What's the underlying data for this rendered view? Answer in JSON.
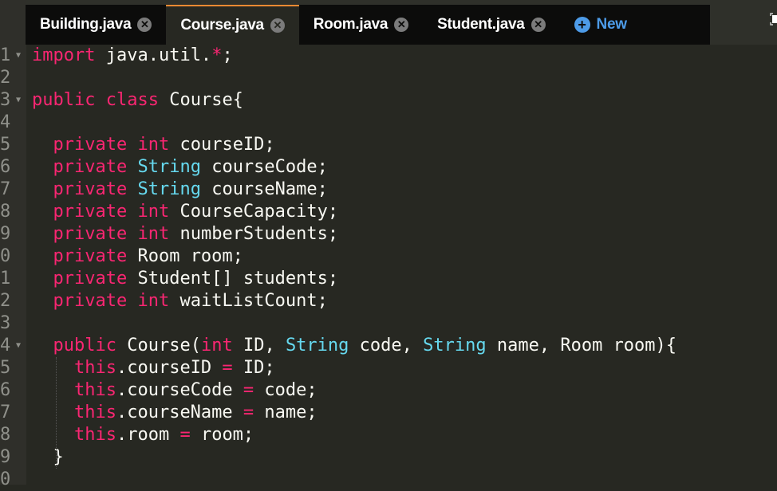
{
  "tabs": [
    {
      "label": "Building.java",
      "active": false
    },
    {
      "label": "Course.java",
      "active": true
    },
    {
      "label": "Room.java",
      "active": false
    },
    {
      "label": "Student.java",
      "active": false
    }
  ],
  "new_tab_label": "New",
  "colors": {
    "background": "#272822",
    "keyword": "#f92672",
    "type": "#66d9ef",
    "text": "#f8f8f2",
    "active_tab_accent": "#f58a33",
    "new_button": "#4d9be8"
  },
  "code_lines": [
    {
      "n": "1",
      "fold": true
    },
    {
      "n": "2"
    },
    {
      "n": "3",
      "fold": true
    },
    {
      "n": "4"
    },
    {
      "n": "5"
    },
    {
      "n": "6"
    },
    {
      "n": "7"
    },
    {
      "n": "8"
    },
    {
      "n": "9"
    },
    {
      "n": "0"
    },
    {
      "n": "1"
    },
    {
      "n": "2"
    },
    {
      "n": "3"
    },
    {
      "n": "4",
      "fold": true
    },
    {
      "n": "5"
    },
    {
      "n": "6"
    },
    {
      "n": "7"
    },
    {
      "n": "8"
    },
    {
      "n": "9"
    },
    {
      "n": "0"
    }
  ],
  "code": [
    [
      [
        "kw",
        "import"
      ],
      [
        "t",
        " java.util."
      ],
      [
        "kw",
        "*"
      ],
      [
        "t",
        ";"
      ]
    ],
    [],
    [
      [
        "kw",
        "public"
      ],
      [
        "t",
        " "
      ],
      [
        "kw",
        "class"
      ],
      [
        "t",
        " Course{"
      ]
    ],
    [],
    [
      [
        "t",
        "  "
      ],
      [
        "kw",
        "private"
      ],
      [
        "t",
        " "
      ],
      [
        "kw",
        "int"
      ],
      [
        "t",
        " courseID;"
      ]
    ],
    [
      [
        "t",
        "  "
      ],
      [
        "kw",
        "private"
      ],
      [
        "t",
        " "
      ],
      [
        "ty",
        "String"
      ],
      [
        "t",
        " courseCode;"
      ]
    ],
    [
      [
        "t",
        "  "
      ],
      [
        "kw",
        "private"
      ],
      [
        "t",
        " "
      ],
      [
        "ty",
        "String"
      ],
      [
        "t",
        " courseName;"
      ]
    ],
    [
      [
        "t",
        "  "
      ],
      [
        "kw",
        "private"
      ],
      [
        "t",
        " "
      ],
      [
        "kw",
        "int"
      ],
      [
        "t",
        " CourseCapacity;"
      ]
    ],
    [
      [
        "t",
        "  "
      ],
      [
        "kw",
        "private"
      ],
      [
        "t",
        " "
      ],
      [
        "kw",
        "int"
      ],
      [
        "t",
        " numberStudents;"
      ]
    ],
    [
      [
        "t",
        "  "
      ],
      [
        "kw",
        "private"
      ],
      [
        "t",
        " Room room;"
      ]
    ],
    [
      [
        "t",
        "  "
      ],
      [
        "kw",
        "private"
      ],
      [
        "t",
        " Student[] students;"
      ]
    ],
    [
      [
        "t",
        "  "
      ],
      [
        "kw",
        "private"
      ],
      [
        "t",
        " "
      ],
      [
        "kw",
        "int"
      ],
      [
        "t",
        " waitListCount;"
      ]
    ],
    [],
    [
      [
        "t",
        "  "
      ],
      [
        "kw",
        "public"
      ],
      [
        "t",
        " Course("
      ],
      [
        "kw",
        "int"
      ],
      [
        "t",
        " ID, "
      ],
      [
        "ty",
        "String"
      ],
      [
        "t",
        " code, "
      ],
      [
        "ty",
        "String"
      ],
      [
        "t",
        " name, Room room){"
      ]
    ],
    [
      [
        "t",
        "    "
      ],
      [
        "kw",
        "this"
      ],
      [
        "t",
        ".courseID "
      ],
      [
        "kw",
        "="
      ],
      [
        "t",
        " ID;"
      ]
    ],
    [
      [
        "t",
        "    "
      ],
      [
        "kw",
        "this"
      ],
      [
        "t",
        ".courseCode "
      ],
      [
        "kw",
        "="
      ],
      [
        "t",
        " code;"
      ]
    ],
    [
      [
        "t",
        "    "
      ],
      [
        "kw",
        "this"
      ],
      [
        "t",
        ".courseName "
      ],
      [
        "kw",
        "="
      ],
      [
        "t",
        " name;"
      ]
    ],
    [
      [
        "t",
        "    "
      ],
      [
        "kw",
        "this"
      ],
      [
        "t",
        ".room "
      ],
      [
        "kw",
        "="
      ],
      [
        "t",
        " room;"
      ]
    ],
    [
      [
        "t",
        "  }"
      ]
    ],
    []
  ]
}
